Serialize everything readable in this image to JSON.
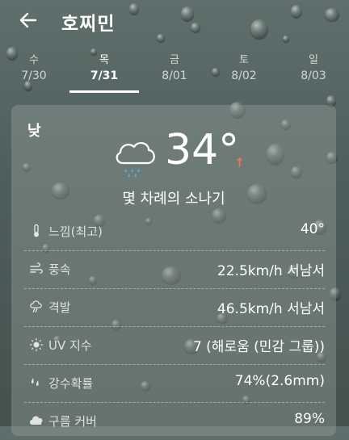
{
  "header": {
    "title": "호찌민"
  },
  "tabs": [
    {
      "dow": "수",
      "date": "7/30"
    },
    {
      "dow": "목",
      "date": "7/31"
    },
    {
      "dow": "금",
      "date": "8/01"
    },
    {
      "dow": "토",
      "date": "8/02"
    },
    {
      "dow": "일",
      "date": "8/03"
    }
  ],
  "selected_tab": 1,
  "card": {
    "period": "낮",
    "temperature": "34°",
    "trend": "↑",
    "condition": "몇 차례의 소나기",
    "rows": [
      {
        "icon": "thermometer-icon",
        "label": "느낌(최고)",
        "value": "40°"
      },
      {
        "icon": "wind-icon",
        "label": "풍속",
        "value": "22.5km/h 서남서"
      },
      {
        "icon": "gust-icon",
        "label": "격발",
        "value": "46.5km/h 서남서"
      },
      {
        "icon": "sun-icon",
        "label": "UV 지수",
        "value": "7 (해로움 (민감 그룹))"
      },
      {
        "icon": "rain-drops-icon",
        "label": "강수확률",
        "value": "74%(2.6mm)"
      },
      {
        "icon": "cloud-icon",
        "label": "구름 커버",
        "value": "89%"
      }
    ]
  },
  "colors": {
    "accent_arrow": "#e0785a",
    "rain_icon": "#5aa7e0"
  }
}
